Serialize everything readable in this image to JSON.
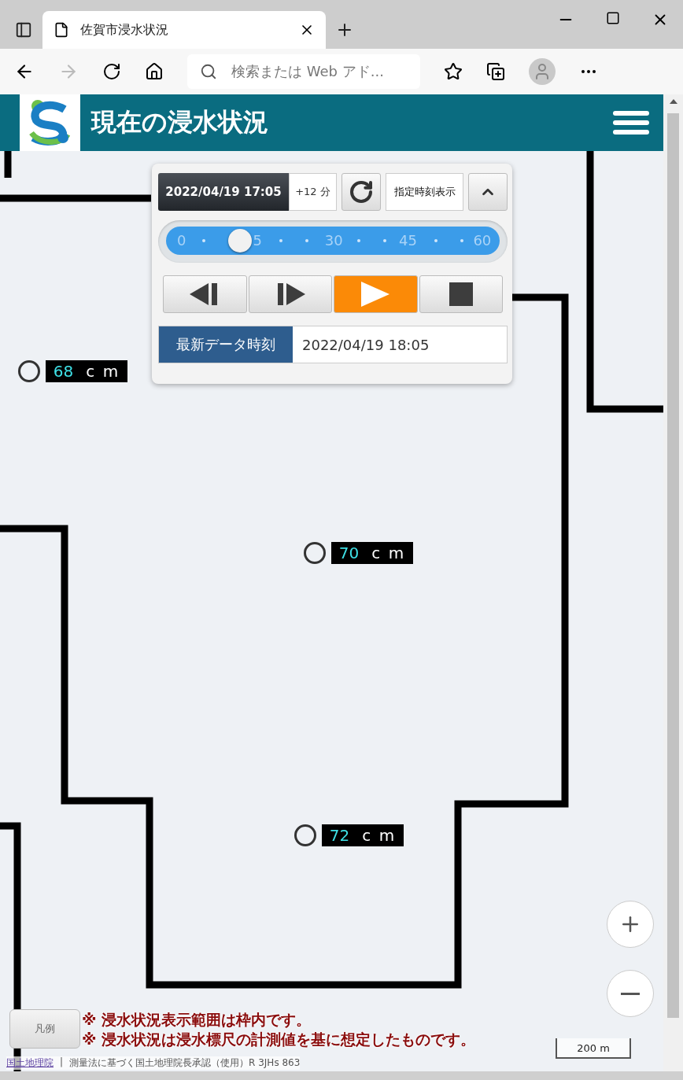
{
  "browser": {
    "tab_title": "佐賀市浸水状況",
    "address_placeholder": "検索または Web アド..."
  },
  "header": {
    "title": "現在の浸水状況"
  },
  "time_panel": {
    "display_time": "2022/04/19 17:05",
    "offset": "+12 分",
    "specified_time_button": "指定時刻表示",
    "slider": {
      "level": 0.2,
      "tick_labels": [
        "0",
        "5",
        "30",
        "45",
        "60"
      ]
    },
    "playback_buttons": [
      {
        "kind": "step_back",
        "selected": false
      },
      {
        "kind": "step_forward",
        "selected": false
      },
      {
        "kind": "play",
        "selected": true
      },
      {
        "kind": "stop",
        "selected": false
      }
    ],
    "latest_label": "最新データ時刻",
    "latest_time": "2022/04/19 18:05"
  },
  "markers": [
    {
      "value": "68",
      "unit": "c m"
    },
    {
      "value": "70",
      "unit": "c m"
    },
    {
      "value": "72",
      "unit": "c m"
    }
  ],
  "legend_button": "凡例",
  "notes": [
    "※ 浸水状況表示範囲は枠内です。",
    "※ 浸水状況は浸水標尺の計測値を基に想定したものです。"
  ],
  "scale": "200 m",
  "attribution": {
    "link": "国土地理院",
    "separator": "|",
    "text": "測量法に基づく国土地理院長承認（使用）R 3JHs 863"
  }
}
